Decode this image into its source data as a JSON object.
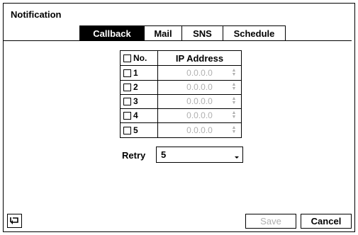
{
  "window": {
    "title": "Notification"
  },
  "tabs": [
    {
      "label": "Callback",
      "active": true
    },
    {
      "label": "Mail",
      "active": false
    },
    {
      "label": "SNS",
      "active": false
    },
    {
      "label": "Schedule",
      "active": false
    }
  ],
  "ip_table": {
    "headers": {
      "no": "No.",
      "ip": "IP Address"
    },
    "rows": [
      {
        "no": "1",
        "ip": "0.0.0.0",
        "checked": false
      },
      {
        "no": "2",
        "ip": "0.0.0.0",
        "checked": false
      },
      {
        "no": "3",
        "ip": "0.0.0.0",
        "checked": false
      },
      {
        "no": "4",
        "ip": "0.0.0.0",
        "checked": false
      },
      {
        "no": "5",
        "ip": "0.0.0.0",
        "checked": false
      }
    ]
  },
  "retry": {
    "label": "Retry",
    "value": "5"
  },
  "footer": {
    "save_label": "Save",
    "cancel_label": "Cancel",
    "back_icon": "back-arrow-icon"
  },
  "colors": {
    "active_tab_bg": "#000000",
    "disabled_text": "#b0b0b0"
  }
}
